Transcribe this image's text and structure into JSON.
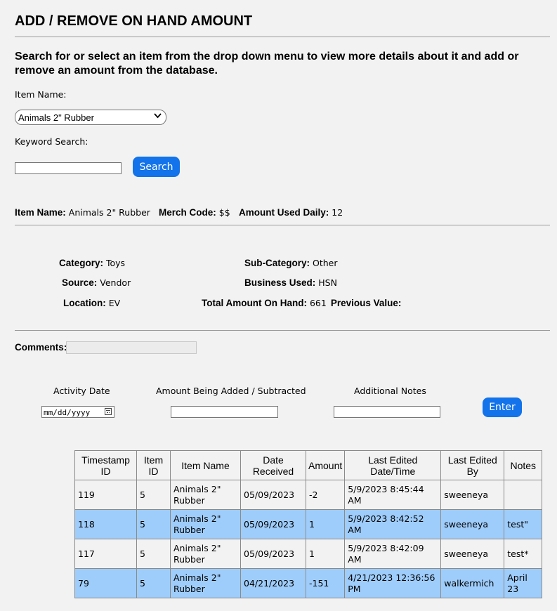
{
  "page": {
    "title": "ADD / REMOVE ON HAND AMOUNT",
    "intro": "Search for or select an item from the drop down menu to view more details about it and add or remove an amount from the database."
  },
  "selector": {
    "item_name_label": "Item Name:",
    "selected_item": "Animals 2\" Rubber",
    "keyword_label": "Keyword Search:",
    "keyword_value": "",
    "search_button": "Search"
  },
  "summary": {
    "item_name_label": "Item Name:",
    "item_name": "Animals 2\" Rubber",
    "merch_code_label": "Merch Code:",
    "merch_code": "$$",
    "amount_used_label": "Amount Used Daily:",
    "amount_used": "12"
  },
  "details": {
    "category_label": "Category:",
    "category": "Toys",
    "source_label": "Source:",
    "source": "Vendor",
    "location_label": "Location:",
    "location": "EV",
    "subcategory_label": "Sub-Category:",
    "subcategory": "Other",
    "business_label": "Business Used:",
    "business": "HSN",
    "total_label": "Total Amount On Hand:",
    "total": "661",
    "previous_label": "Previous Value:",
    "previous": ""
  },
  "form": {
    "comments_label": "Comments:",
    "activity_date_label": "Activity Date",
    "activity_date_placeholder": "mm/dd/yyyy",
    "amount_label": "Amount Being Added / Subtracted",
    "notes_label": "Additional Notes",
    "enter_button": "Enter"
  },
  "table": {
    "headers": [
      "Timestamp ID",
      "Item ID",
      "Item Name",
      "Date Received",
      "Amount",
      "Last Edited Date/Time",
      "Last Edited By",
      "Notes"
    ],
    "rows": [
      {
        "timestamp_id": "119",
        "item_id": "5",
        "item_name": "Animals 2\" Rubber",
        "date_received": "05/09/2023",
        "amount": "-2",
        "last_edited": "5/9/2023 8:45:44 AM",
        "edited_by": "sweeneya",
        "notes": ""
      },
      {
        "timestamp_id": "118",
        "item_id": "5",
        "item_name": "Animals 2\" Rubber",
        "date_received": "05/09/2023",
        "amount": "1",
        "last_edited": "5/9/2023 8:42:52 AM",
        "edited_by": "sweeneya",
        "notes": "test\""
      },
      {
        "timestamp_id": "117",
        "item_id": "5",
        "item_name": "Animals 2\" Rubber",
        "date_received": "05/09/2023",
        "amount": "1",
        "last_edited": "5/9/2023 8:42:09 AM",
        "edited_by": "sweeneya",
        "notes": "test*"
      },
      {
        "timestamp_id": "79",
        "item_id": "5",
        "item_name": "Animals 2\" Rubber",
        "date_received": "04/21/2023",
        "amount": "-151",
        "last_edited": "4/21/2023 12:36:56 PM",
        "edited_by": "walkermich",
        "notes": "April 23"
      }
    ]
  },
  "colors": {
    "button": "#1273eb",
    "row_highlight": "#9fcdfb",
    "background": "#f2f2f2"
  }
}
